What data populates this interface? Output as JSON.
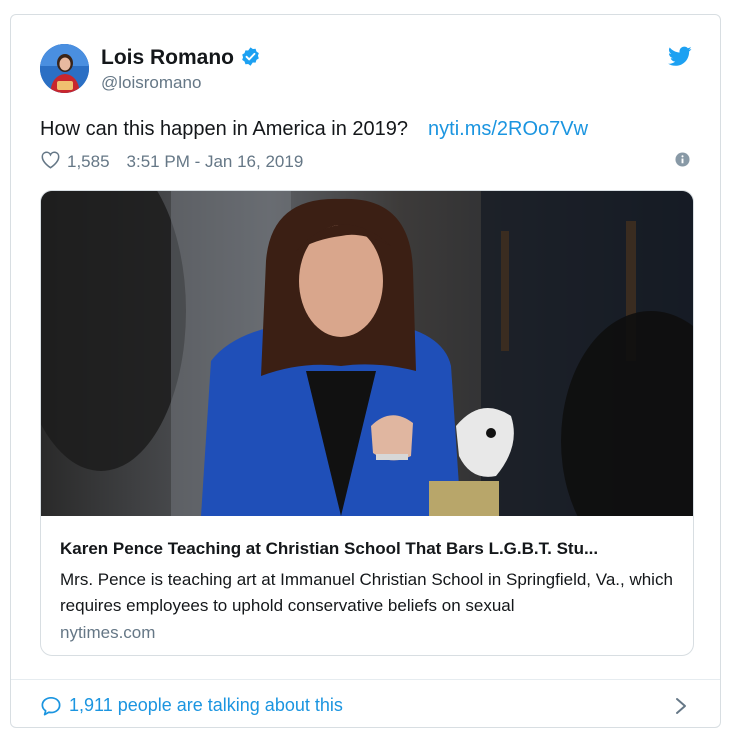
{
  "author": {
    "name": "Lois Romano",
    "handle": "@loisromano"
  },
  "tweet": {
    "text": "How can this happen in America in 2019?",
    "link": "nyti.ms/2ROo7Vw",
    "likes": "1,585",
    "timestamp": "3:51 PM - Jan 16, 2019"
  },
  "card": {
    "title": "Karen Pence Teaching at Christian School That Bars L.G.B.T. Stu...",
    "description": "Mrs. Pence is teaching art at Immanuel Christian School in Springfield, Va., which requires employees to uphold conservative beliefs on sexual",
    "domain": "nytimes.com"
  },
  "footer": {
    "talking": "1,911 people are talking about this"
  },
  "colors": {
    "accent": "#1b95e0",
    "text": "#14171a",
    "muted": "#657786"
  },
  "icons": [
    "verified-badge-icon",
    "twitter-bird-icon",
    "heart-icon",
    "info-icon",
    "comment-icon",
    "chevron-right-icon"
  ]
}
